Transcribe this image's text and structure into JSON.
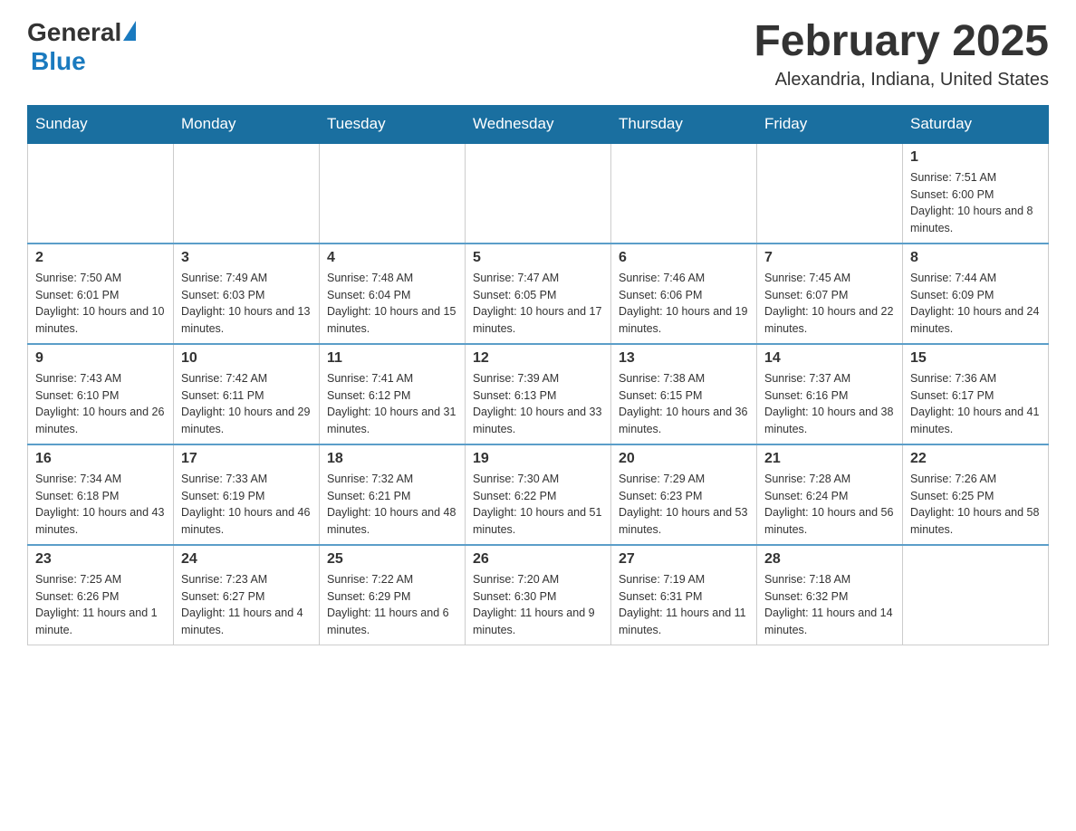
{
  "header": {
    "logo_general": "General",
    "logo_blue": "Blue",
    "month_title": "February 2025",
    "location": "Alexandria, Indiana, United States"
  },
  "weekdays": [
    "Sunday",
    "Monday",
    "Tuesday",
    "Wednesday",
    "Thursday",
    "Friday",
    "Saturday"
  ],
  "weeks": [
    [
      {
        "day": "",
        "info": ""
      },
      {
        "day": "",
        "info": ""
      },
      {
        "day": "",
        "info": ""
      },
      {
        "day": "",
        "info": ""
      },
      {
        "day": "",
        "info": ""
      },
      {
        "day": "",
        "info": ""
      },
      {
        "day": "1",
        "info": "Sunrise: 7:51 AM\nSunset: 6:00 PM\nDaylight: 10 hours and 8 minutes."
      }
    ],
    [
      {
        "day": "2",
        "info": "Sunrise: 7:50 AM\nSunset: 6:01 PM\nDaylight: 10 hours and 10 minutes."
      },
      {
        "day": "3",
        "info": "Sunrise: 7:49 AM\nSunset: 6:03 PM\nDaylight: 10 hours and 13 minutes."
      },
      {
        "day": "4",
        "info": "Sunrise: 7:48 AM\nSunset: 6:04 PM\nDaylight: 10 hours and 15 minutes."
      },
      {
        "day": "5",
        "info": "Sunrise: 7:47 AM\nSunset: 6:05 PM\nDaylight: 10 hours and 17 minutes."
      },
      {
        "day": "6",
        "info": "Sunrise: 7:46 AM\nSunset: 6:06 PM\nDaylight: 10 hours and 19 minutes."
      },
      {
        "day": "7",
        "info": "Sunrise: 7:45 AM\nSunset: 6:07 PM\nDaylight: 10 hours and 22 minutes."
      },
      {
        "day": "8",
        "info": "Sunrise: 7:44 AM\nSunset: 6:09 PM\nDaylight: 10 hours and 24 minutes."
      }
    ],
    [
      {
        "day": "9",
        "info": "Sunrise: 7:43 AM\nSunset: 6:10 PM\nDaylight: 10 hours and 26 minutes."
      },
      {
        "day": "10",
        "info": "Sunrise: 7:42 AM\nSunset: 6:11 PM\nDaylight: 10 hours and 29 minutes."
      },
      {
        "day": "11",
        "info": "Sunrise: 7:41 AM\nSunset: 6:12 PM\nDaylight: 10 hours and 31 minutes."
      },
      {
        "day": "12",
        "info": "Sunrise: 7:39 AM\nSunset: 6:13 PM\nDaylight: 10 hours and 33 minutes."
      },
      {
        "day": "13",
        "info": "Sunrise: 7:38 AM\nSunset: 6:15 PM\nDaylight: 10 hours and 36 minutes."
      },
      {
        "day": "14",
        "info": "Sunrise: 7:37 AM\nSunset: 6:16 PM\nDaylight: 10 hours and 38 minutes."
      },
      {
        "day": "15",
        "info": "Sunrise: 7:36 AM\nSunset: 6:17 PM\nDaylight: 10 hours and 41 minutes."
      }
    ],
    [
      {
        "day": "16",
        "info": "Sunrise: 7:34 AM\nSunset: 6:18 PM\nDaylight: 10 hours and 43 minutes."
      },
      {
        "day": "17",
        "info": "Sunrise: 7:33 AM\nSunset: 6:19 PM\nDaylight: 10 hours and 46 minutes."
      },
      {
        "day": "18",
        "info": "Sunrise: 7:32 AM\nSunset: 6:21 PM\nDaylight: 10 hours and 48 minutes."
      },
      {
        "day": "19",
        "info": "Sunrise: 7:30 AM\nSunset: 6:22 PM\nDaylight: 10 hours and 51 minutes."
      },
      {
        "day": "20",
        "info": "Sunrise: 7:29 AM\nSunset: 6:23 PM\nDaylight: 10 hours and 53 minutes."
      },
      {
        "day": "21",
        "info": "Sunrise: 7:28 AM\nSunset: 6:24 PM\nDaylight: 10 hours and 56 minutes."
      },
      {
        "day": "22",
        "info": "Sunrise: 7:26 AM\nSunset: 6:25 PM\nDaylight: 10 hours and 58 minutes."
      }
    ],
    [
      {
        "day": "23",
        "info": "Sunrise: 7:25 AM\nSunset: 6:26 PM\nDaylight: 11 hours and 1 minute."
      },
      {
        "day": "24",
        "info": "Sunrise: 7:23 AM\nSunset: 6:27 PM\nDaylight: 11 hours and 4 minutes."
      },
      {
        "day": "25",
        "info": "Sunrise: 7:22 AM\nSunset: 6:29 PM\nDaylight: 11 hours and 6 minutes."
      },
      {
        "day": "26",
        "info": "Sunrise: 7:20 AM\nSunset: 6:30 PM\nDaylight: 11 hours and 9 minutes."
      },
      {
        "day": "27",
        "info": "Sunrise: 7:19 AM\nSunset: 6:31 PM\nDaylight: 11 hours and 11 minutes."
      },
      {
        "day": "28",
        "info": "Sunrise: 7:18 AM\nSunset: 6:32 PM\nDaylight: 11 hours and 14 minutes."
      },
      {
        "day": "",
        "info": ""
      }
    ]
  ]
}
